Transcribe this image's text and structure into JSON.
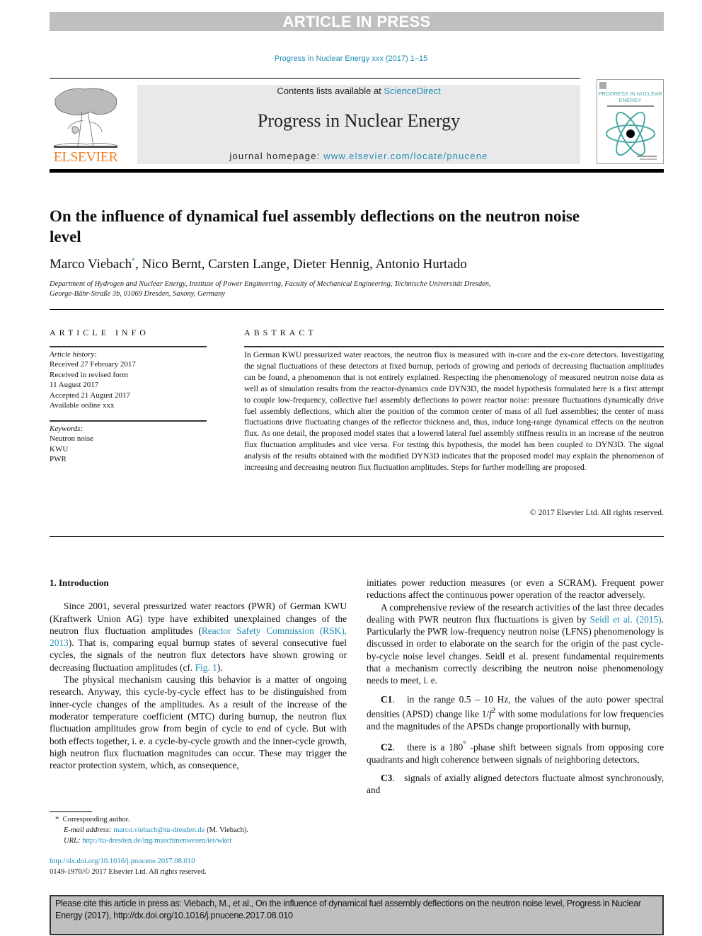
{
  "banner": {
    "text": "ARTICLE IN PRESS"
  },
  "journal_citation": "Progress in Nuclear Energy xxx (2017) 1–15",
  "header": {
    "publisher_logo": "ELSEVIER",
    "contents_prefix": "Contents lists available at ",
    "contents_link": "ScienceDirect",
    "journal_title": "Progress in Nuclear Energy",
    "homepage_prefix": "journal homepage: ",
    "homepage_link": "www.elsevier.com/locate/pnucene",
    "cover_title": "PROGRESS IN NUCLEAR ENERGY",
    "accent_color": "#1f8bb6",
    "logo_color": "#f0832a"
  },
  "article": {
    "title": "On the influence of dynamical fuel assembly deflections on the neutron noise level",
    "authors": [
      {
        "name": "Marco Viebach",
        "mark": "*"
      },
      {
        "name": "Nico Bernt"
      },
      {
        "name": "Carsten Lange"
      },
      {
        "name": "Dieter Hennig"
      },
      {
        "name": "Antonio Hurtado"
      }
    ],
    "affiliation_line1": "Department of Hydrogen and Nuclear Energy, Institute of Power Engineering, Faculty of Mechanical Engineering, Technische Universität Dresden,",
    "affiliation_line2": "George-Bähr-Straße 3b, 01069 Dresden, Saxony, Germany"
  },
  "article_info": {
    "heading": "ARTICLE INFO",
    "history_label": "Article history:",
    "history": [
      "Received 27 February 2017",
      "Received in revised form",
      "11 August 2017",
      "Accepted 21 August 2017",
      "Available online xxx"
    ],
    "keywords_label": "Keywords:",
    "keywords": [
      "Neutron noise",
      "KWU",
      "PWR"
    ]
  },
  "abstract": {
    "heading": "ABSTRACT",
    "text": "In German KWU pressurized water reactors, the neutron flux is measured with in-core and the ex-core detectors. Investigating the signal fluctuations of these detectors at fixed burnup, periods of growing and periods of decreasing fluctuation amplitudes can be found, a phenomenon that is not entirely explained. Respecting the phenomenology of measured neutron noise data as well as of simulation results from the reactor-dynamics code DYN3D, the model hypothesis formulated here is a first attempt to couple low-frequency, collective fuel assembly deflections to power reactor noise: pressure fluctuations dynamically drive fuel assembly deflections, which alter the position of the common center of mass of all fuel assemblies; the center of mass fluctuations drive fluctuating changes of the reflector thickness and, thus, induce long-range dynamical effects on the neutron flux. As one detail, the proposed model states that a lowered lateral fuel assembly stiffness results in an increase of the neutron flux fluctuation amplitudes and vice versa. For testing this hypothesis, the model has been coupled to DYN3D. The signal analysis of the results obtained with the modified DYN3D indicates that the proposed model may explain the phenomenon of increasing and decreasing neutron flux fluctuation amplitudes. Steps for further modelling are proposed.",
    "copyright": "© 2017 Elsevier Ltd. All rights reserved."
  },
  "body": {
    "section_heading": "1.  Introduction",
    "p1_a": "Since 2001, several pressurized water reactors (PWR) of German KWU (Kraftwerk Union AG) type have exhibited unexplained changes of the neutron flux fluctuation amplitudes (",
    "p1_link1": "Reactor Safety Commission (RSK), 2013",
    "p1_b": "). That is, comparing equal burnup states of several consecutive fuel cycles, the signals of the neutron flux detectors have shown growing or decreasing fluctuation amplitudes (cf. ",
    "p1_link2": "Fig. 1",
    "p1_c": ").",
    "p2": "The physical mechanism causing this behavior is a matter of ongoing research. Anyway, this cycle-by-cycle effect has to be distinguished from inner-cycle changes of the amplitudes. As a result of the increase of the moderator temperature coefficient (MTC) during burnup, the neutron flux fluctuation amplitudes grow from begin of cycle to end of cycle. But with both effects together, i. e. a cycle-by-cycle growth and the inner-cycle growth, high neutron flux fluctuation magnitudes can occur. These may trigger the reactor protection system, which, as consequence,",
    "p3": "initiates power reduction measures (or even a SCRAM). Frequent power reductions affect the continuous power operation of the reactor adversely.",
    "p4_a": "A comprehensive review of the research activities of the last three decades dealing with PWR neutron flux fluctuations is given by ",
    "p4_link": "Seidl et al. (2015)",
    "p4_b": ". Particularly the PWR low-frequency neutron noise (LFNS) phenomenology is discussed in order to elaborate on the search for the origin of the past cycle-by-cycle noise level changes. Seidl et al. present fundamental requirements that a mechanism correctly describing the neutron noise phenomenology needs to meet, i. e.",
    "criteria": [
      {
        "label": "C1",
        "text_a": "in the range 0.5 – 10 Hz, the values of the auto power spectral densities (APSD) change like 1/",
        "math": "f",
        "sup": "2",
        "text_b": " with some modulations for low frequencies and the magnitudes of the APSDs change proportionally with burnup,"
      },
      {
        "label": "C2",
        "text_a": "there is a 180",
        "sup": "°",
        "text_b": " -phase shift between signals from opposing core quadrants and high coherence between signals of neighboring detectors,"
      },
      {
        "label": "C3",
        "text_a": "signals of axially aligned detectors fluctuate almost synchronously, and"
      }
    ]
  },
  "footnotes": {
    "mark": "*",
    "corresponding": "Corresponding author.",
    "email_label": "E-mail address:",
    "email": "marco.viebach@tu-dresden.de",
    "email_suffix": " (M. Viebach).",
    "url_label": "URL:",
    "url": "http://tu-dresden.de/ing/maschinenwesen/iet/wket",
    "doi": "http://dx.doi.org/10.1016/j.pnucene.2017.08.010",
    "issn": "0149-1970/© 2017 Elsevier Ltd. All rights reserved."
  },
  "cite_box": {
    "text": "Please cite this article in press as: Viebach, M., et al., On the influence of dynamical fuel assembly deflections on the neutron noise level, Progress in Nuclear Energy (2017), http://dx.doi.org/10.1016/j.pnucene.2017.08.010"
  }
}
